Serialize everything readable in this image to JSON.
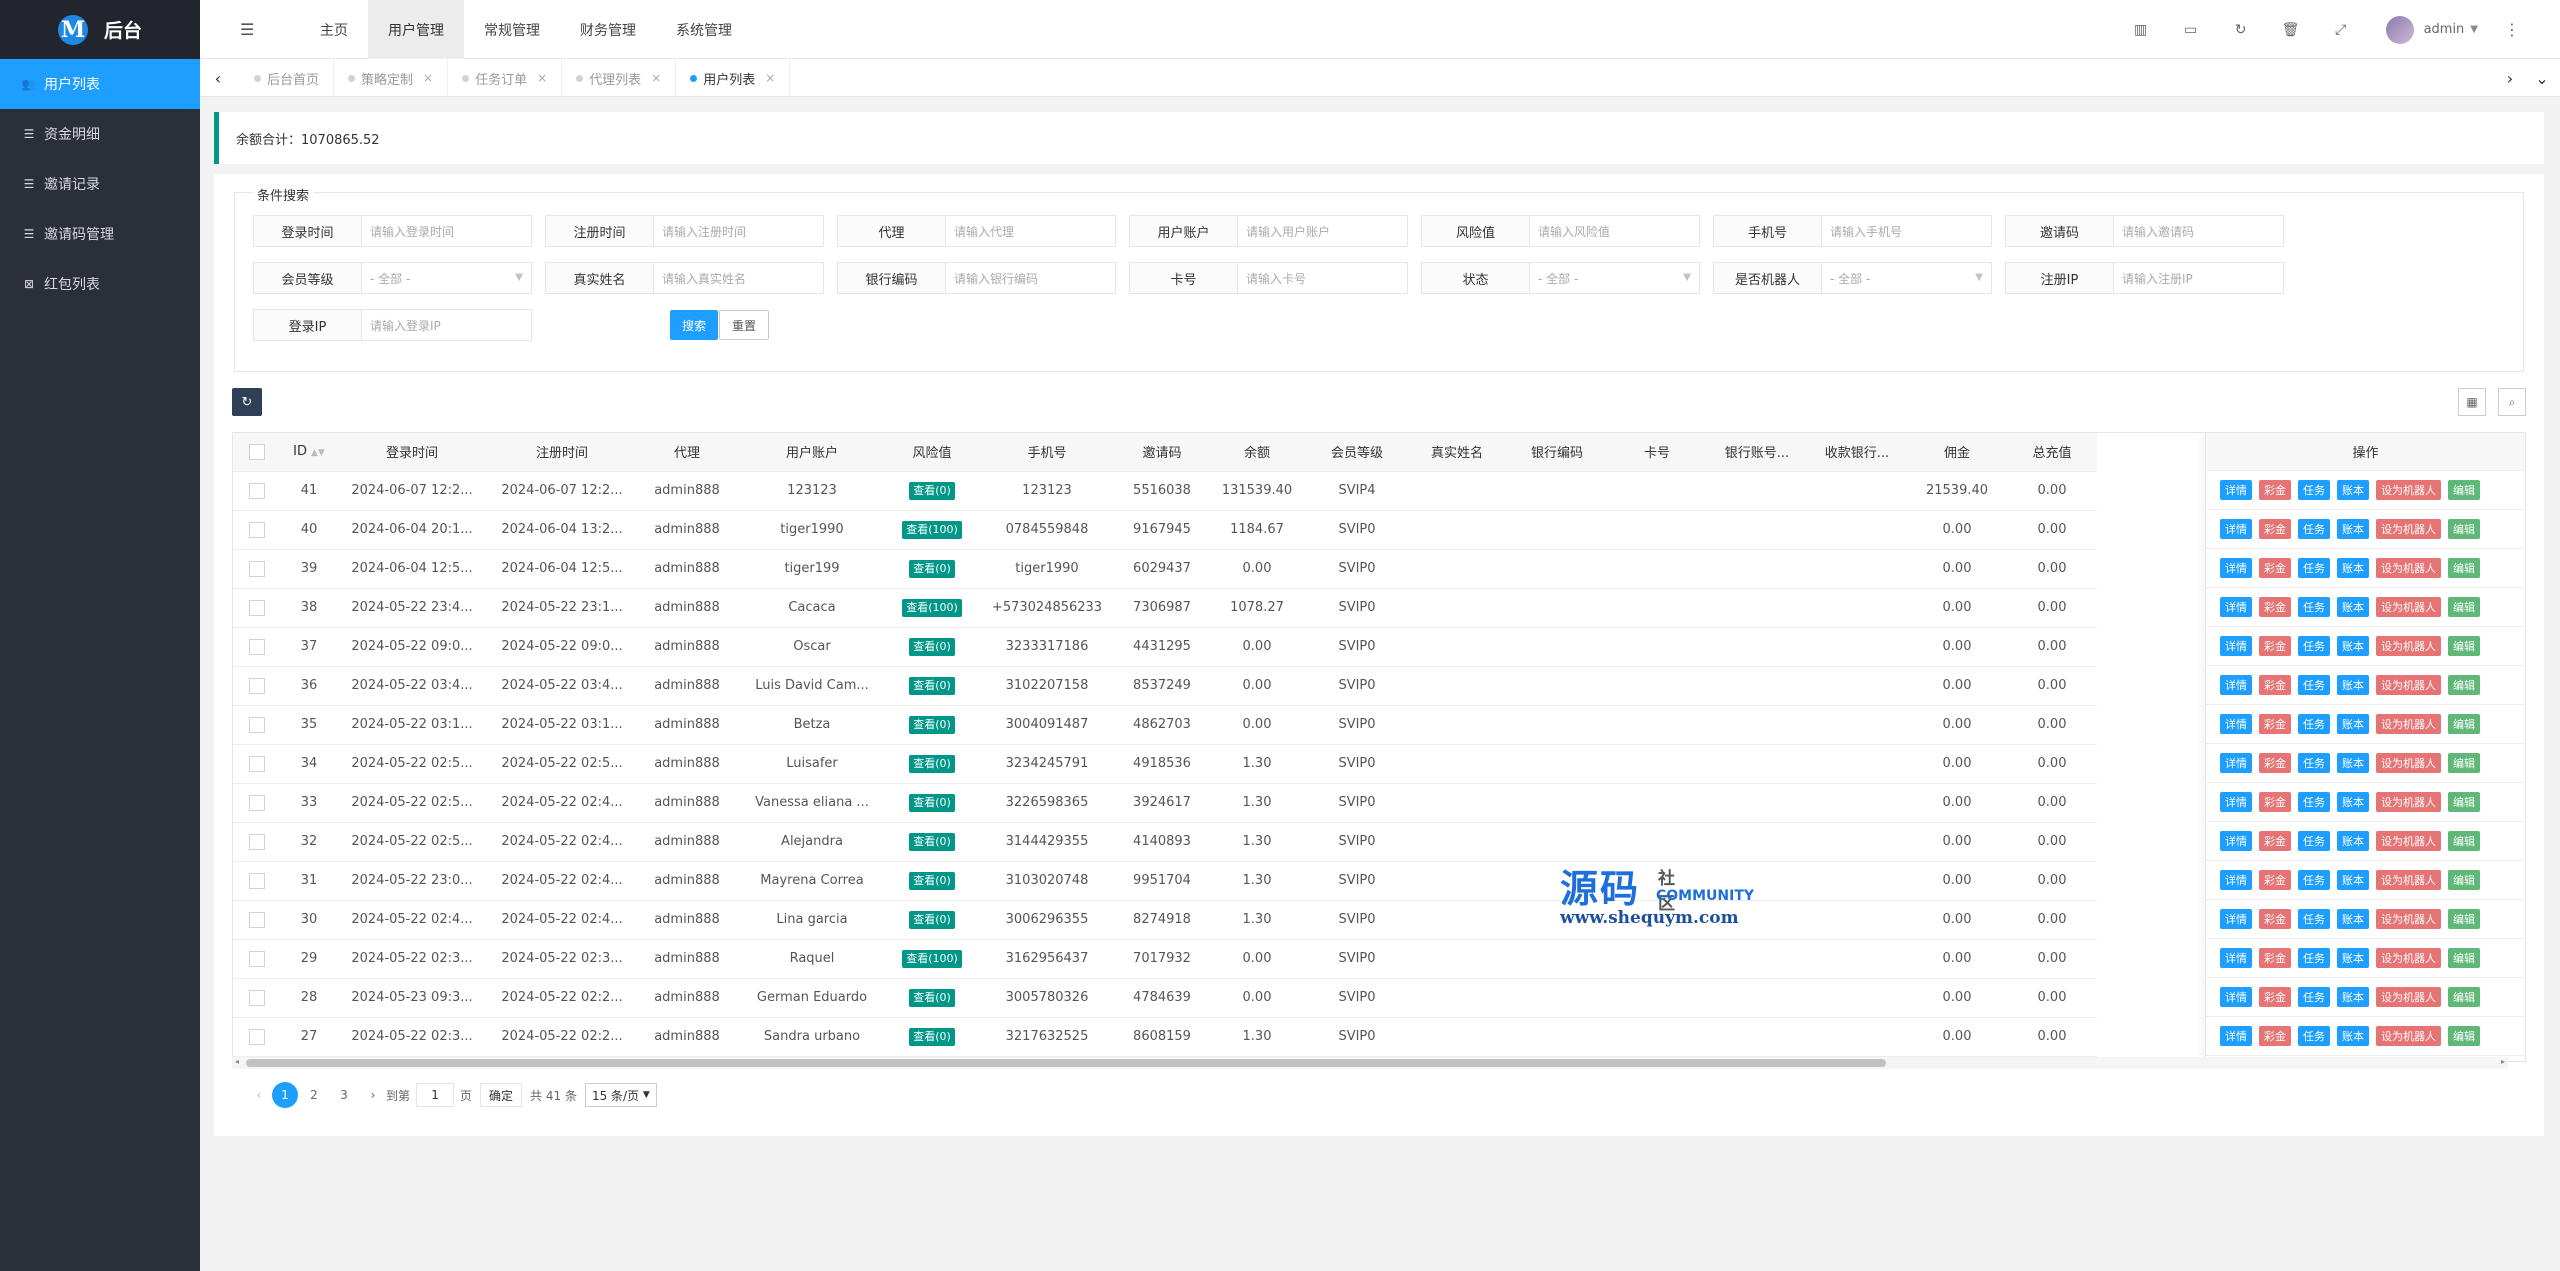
{
  "brand": {
    "mark": "M",
    "title": "后台"
  },
  "sidebar": {
    "items": [
      {
        "label": "用户列表",
        "icon": "users-icon",
        "glyph": "👥",
        "active": true
      },
      {
        "label": "资金明细",
        "icon": "list-icon",
        "glyph": "☰",
        "active": false
      },
      {
        "label": "邀请记录",
        "icon": "list-icon",
        "glyph": "☰",
        "active": false
      },
      {
        "label": "邀请码管理",
        "icon": "list-icon",
        "glyph": "☰",
        "active": false
      },
      {
        "label": "红包列表",
        "icon": "gift-icon",
        "glyph": "⊠",
        "active": false
      }
    ]
  },
  "header": {
    "nav": [
      "主页",
      "用户管理",
      "常规管理",
      "财务管理",
      "系统管理"
    ],
    "active_nav": 1,
    "user": "admin"
  },
  "tabs": [
    {
      "label": "后台首页",
      "active": false,
      "closable": false
    },
    {
      "label": "策略定制",
      "active": false,
      "closable": true
    },
    {
      "label": "任务订单",
      "active": false,
      "closable": true
    },
    {
      "label": "代理列表",
      "active": false,
      "closable": true
    },
    {
      "label": "用户列表",
      "active": true,
      "closable": true
    }
  ],
  "summary": {
    "text": "余额合计：1070865.52"
  },
  "search": {
    "legend": "条件搜索",
    "row1": [
      {
        "label": "登录时间",
        "placeholder": "请输入登录时间",
        "type": "input"
      },
      {
        "label": "注册时间",
        "placeholder": "请输入注册时间",
        "type": "input"
      },
      {
        "label": "代理",
        "placeholder": "请输入代理",
        "type": "input"
      },
      {
        "label": "用户账户",
        "placeholder": "请输入用户账户",
        "type": "input"
      },
      {
        "label": "风险值",
        "placeholder": "请输入风险值",
        "type": "input"
      },
      {
        "label": "手机号",
        "placeholder": "请输入手机号",
        "type": "input"
      },
      {
        "label": "邀请码",
        "placeholder": "请输入邀请码",
        "type": "input"
      }
    ],
    "row2": [
      {
        "label": "会员等级",
        "placeholder": "- 全部 -",
        "type": "select"
      },
      {
        "label": "真实姓名",
        "placeholder": "请输入真实姓名",
        "type": "input"
      },
      {
        "label": "银行编码",
        "placeholder": "请输入银行编码",
        "type": "input"
      },
      {
        "label": "卡号",
        "placeholder": "请输入卡号",
        "type": "input"
      },
      {
        "label": "状态",
        "placeholder": "- 全部 -",
        "type": "select"
      },
      {
        "label": "是否机器人",
        "placeholder": "- 全部 -",
        "type": "select"
      },
      {
        "label": "注册IP",
        "placeholder": "请输入注册IP",
        "type": "input"
      }
    ],
    "row3": [
      {
        "label": "登录IP",
        "placeholder": "请输入登录IP",
        "type": "input"
      }
    ],
    "search_btn": "搜索",
    "reset_btn": "重置"
  },
  "table": {
    "columns": [
      "ID",
      "登录时间",
      "注册时间",
      "代理",
      "用户账户",
      "风险值",
      "手机号",
      "邀请码",
      "余额",
      "会员等级",
      "真实姓名",
      "银行编码",
      "卡号",
      "银行账号...",
      "收款银行...",
      "佣金",
      "总充值"
    ],
    "ops_header": "操作",
    "ops": [
      {
        "label": "详情",
        "color": "blue"
      },
      {
        "label": "彩金",
        "color": "red"
      },
      {
        "label": "任务",
        "color": "blue"
      },
      {
        "label": "账本",
        "color": "blue"
      },
      {
        "label": "设为机器人",
        "color": "red"
      },
      {
        "label": "编辑",
        "color": "green"
      }
    ],
    "rows": [
      {
        "id": "41",
        "login": "2024-06-07 12:2...",
        "reg": "2024-06-07 12:2...",
        "agent": "admin888",
        "account": "123123",
        "risk": "查看(0)",
        "phone": "123123",
        "invite": "5516038",
        "balance": "131539.40",
        "level": "SVIP4",
        "commission": "21539.40",
        "recharge": "0.00"
      },
      {
        "id": "40",
        "login": "2024-06-04 20:1...",
        "reg": "2024-06-04 13:2...",
        "agent": "admin888",
        "account": "tiger1990",
        "risk": "查看(100)",
        "phone": "0784559848",
        "invite": "9167945",
        "balance": "1184.67",
        "level": "SVIP0",
        "commission": "0.00",
        "recharge": "0.00"
      },
      {
        "id": "39",
        "login": "2024-06-04 12:5...",
        "reg": "2024-06-04 12:5...",
        "agent": "admin888",
        "account": "tiger199",
        "risk": "查看(0)",
        "phone": "tiger1990",
        "invite": "6029437",
        "balance": "0.00",
        "level": "SVIP0",
        "commission": "0.00",
        "recharge": "0.00"
      },
      {
        "id": "38",
        "login": "2024-05-22 23:4...",
        "reg": "2024-05-22 23:1...",
        "agent": "admin888",
        "account": "Cacaca",
        "risk": "查看(100)",
        "phone": "+573024856233",
        "invite": "7306987",
        "balance": "1078.27",
        "level": "SVIP0",
        "commission": "0.00",
        "recharge": "0.00"
      },
      {
        "id": "37",
        "login": "2024-05-22 09:0...",
        "reg": "2024-05-22 09:0...",
        "agent": "admin888",
        "account": "Oscar",
        "risk": "查看(0)",
        "phone": "3233317186",
        "invite": "4431295",
        "balance": "0.00",
        "level": "SVIP0",
        "commission": "0.00",
        "recharge": "0.00"
      },
      {
        "id": "36",
        "login": "2024-05-22 03:4...",
        "reg": "2024-05-22 03:4...",
        "agent": "admin888",
        "account": "Luis David Cam...",
        "risk": "查看(0)",
        "phone": "3102207158",
        "invite": "8537249",
        "balance": "0.00",
        "level": "SVIP0",
        "commission": "0.00",
        "recharge": "0.00"
      },
      {
        "id": "35",
        "login": "2024-05-22 03:1...",
        "reg": "2024-05-22 03:1...",
        "agent": "admin888",
        "account": "Betza",
        "risk": "查看(0)",
        "phone": "3004091487",
        "invite": "4862703",
        "balance": "0.00",
        "level": "SVIP0",
        "commission": "0.00",
        "recharge": "0.00"
      },
      {
        "id": "34",
        "login": "2024-05-22 02:5...",
        "reg": "2024-05-22 02:5...",
        "agent": "admin888",
        "account": "Luisafer",
        "risk": "查看(0)",
        "phone": "3234245791",
        "invite": "4918536",
        "balance": "1.30",
        "level": "SVIP0",
        "commission": "0.00",
        "recharge": "0.00"
      },
      {
        "id": "33",
        "login": "2024-05-22 02:5...",
        "reg": "2024-05-22 02:4...",
        "agent": "admin888",
        "account": "Vanessa eliana ...",
        "risk": "查看(0)",
        "phone": "3226598365",
        "invite": "3924617",
        "balance": "1.30",
        "level": "SVIP0",
        "commission": "0.00",
        "recharge": "0.00"
      },
      {
        "id": "32",
        "login": "2024-05-22 02:5...",
        "reg": "2024-05-22 02:4...",
        "agent": "admin888",
        "account": "Alejandra",
        "risk": "查看(0)",
        "phone": "3144429355",
        "invite": "4140893",
        "balance": "1.30",
        "level": "SVIP0",
        "commission": "0.00",
        "recharge": "0.00"
      },
      {
        "id": "31",
        "login": "2024-05-22 23:0...",
        "reg": "2024-05-22 02:4...",
        "agent": "admin888",
        "account": "Mayrena Correa",
        "risk": "查看(0)",
        "phone": "3103020748",
        "invite": "9951704",
        "balance": "1.30",
        "level": "SVIP0",
        "commission": "0.00",
        "recharge": "0.00"
      },
      {
        "id": "30",
        "login": "2024-05-22 02:4...",
        "reg": "2024-05-22 02:4...",
        "agent": "admin888",
        "account": "Lina garcia",
        "risk": "查看(0)",
        "phone": "3006296355",
        "invite": "8274918",
        "balance": "1.30",
        "level": "SVIP0",
        "commission": "0.00",
        "recharge": "0.00"
      },
      {
        "id": "29",
        "login": "2024-05-22 02:3...",
        "reg": "2024-05-22 02:3...",
        "agent": "admin888",
        "account": "Raquel",
        "risk": "查看(100)",
        "phone": "3162956437",
        "invite": "7017932",
        "balance": "0.00",
        "level": "SVIP0",
        "commission": "0.00",
        "recharge": "0.00"
      },
      {
        "id": "28",
        "login": "2024-05-23 09:3...",
        "reg": "2024-05-22 02:2...",
        "agent": "admin888",
        "account": "German Eduardo",
        "risk": "查看(0)",
        "phone": "3005780326",
        "invite": "4784639",
        "balance": "0.00",
        "level": "SVIP0",
        "commission": "0.00",
        "recharge": "0.00"
      },
      {
        "id": "27",
        "login": "2024-05-22 02:3...",
        "reg": "2024-05-22 02:2...",
        "agent": "admin888",
        "account": "Sandra urbano",
        "risk": "查看(0)",
        "phone": "3217632525",
        "invite": "8608159",
        "balance": "1.30",
        "level": "SVIP0",
        "commission": "0.00",
        "recharge": "0.00"
      }
    ]
  },
  "pager": {
    "pages": [
      "1",
      "2",
      "3"
    ],
    "current": "1",
    "goto_label": "到第",
    "goto_value": "1",
    "page_unit": "页",
    "confirm": "确定",
    "total": "共 41 条",
    "page_size": "15 条/页"
  },
  "watermark": {
    "big": "源码",
    "side": "社区",
    "com": "COMMUNITY",
    "url": "www.shequym.com"
  },
  "colors": {
    "sidebar_bg": "#2b2f3a",
    "accent": "#1e9fff",
    "teal": "#009688",
    "danger": "#e25c5c",
    "success": "#5fb878"
  }
}
